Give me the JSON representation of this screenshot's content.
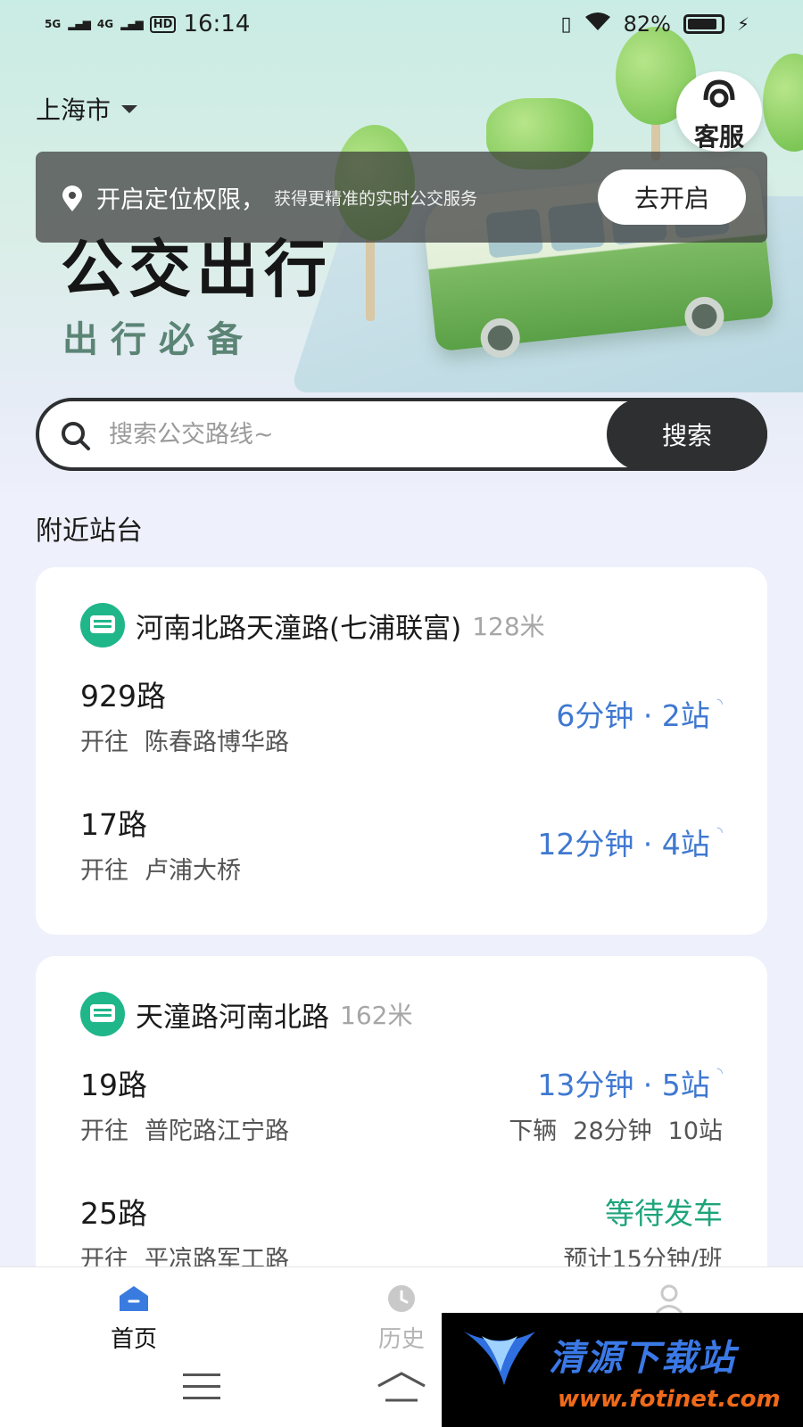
{
  "status_bar": {
    "net1": "5G",
    "net2": "4G",
    "hd": "HD",
    "time": "16:14",
    "battery": "82%"
  },
  "header": {
    "city": "上海市",
    "service_label": "客服"
  },
  "location_banner": {
    "main_text": "开启定位权限，",
    "sub_text": "获得更精准的实时公交服务",
    "button_label": "去开启"
  },
  "hero": {
    "title": "公交出行",
    "subtitle": "出行必备"
  },
  "search": {
    "placeholder": "搜索公交路线~",
    "button_label": "搜索"
  },
  "nearby": {
    "section_title": "附近站台",
    "stations": [
      {
        "name": "河南北路天潼路(七浦联富)",
        "distance": "128米",
        "routes": [
          {
            "number": "929路",
            "dir_label": "开往",
            "destination": "陈春路博华路",
            "eta": "6分钟 · 2站"
          },
          {
            "number": "17路",
            "dir_label": "开往",
            "destination": "卢浦大桥",
            "eta": "12分钟 · 4站"
          }
        ]
      },
      {
        "name": "天潼路河南北路",
        "distance": "162米",
        "routes": [
          {
            "number": "19路",
            "dir_label": "开往",
            "destination": "普陀路江宁路",
            "eta": "13分钟 · 5站",
            "next_label": "下辆",
            "next_time": "28分钟",
            "next_stops": "10站"
          },
          {
            "number": "25路",
            "dir_label": "开往",
            "destination": "平凉路军工路",
            "status": "等待发车",
            "interval": "预计15分钟/班"
          }
        ]
      }
    ]
  },
  "tabbar": {
    "home": "首页",
    "history": "历史"
  },
  "watermark": {
    "title": "清源下载站",
    "url": "www.fotinet.com"
  },
  "colors": {
    "eta_blue": "#3f78d0",
    "status_green": "#1ea47a",
    "station_icon": "#1fb68a",
    "dark": "#2d2f31"
  }
}
